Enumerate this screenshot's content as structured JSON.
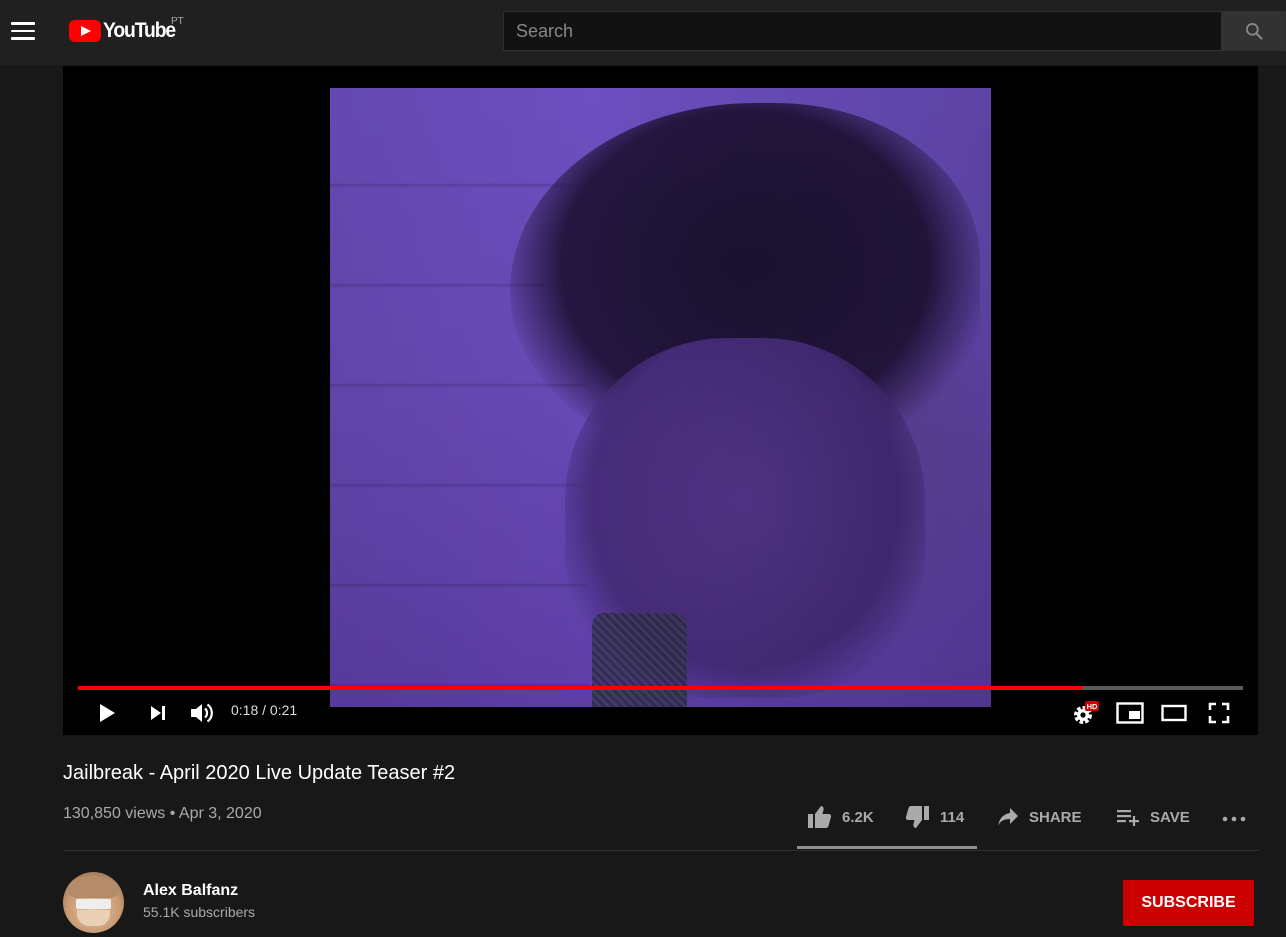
{
  "header": {
    "logo_text": "YouTube",
    "country_code": "PT",
    "search": {
      "placeholder": "Search",
      "value": ""
    }
  },
  "player": {
    "current_time": "0:18",
    "duration": "0:21",
    "time_text": "0:18 / 0:21",
    "progress_fraction": 0.862,
    "quality_badge": "HD",
    "progress_color": "#ff0000"
  },
  "video": {
    "title": "Jailbreak - April 2020 Live Update Teaser #2",
    "views_date": "130,850 views • Apr 3, 2020",
    "likes": "6.2K",
    "dislikes": "114",
    "share_label": "SHARE",
    "save_label": "SAVE"
  },
  "channel": {
    "name": "Alex Balfanz",
    "subscribers": "55.1K subscribers",
    "subscribe_label": "SUBSCRIBE"
  },
  "colors": {
    "accent": "#ff0000",
    "subscribe_bg": "#cc0000",
    "background": "#181818",
    "masthead": "#202020"
  }
}
